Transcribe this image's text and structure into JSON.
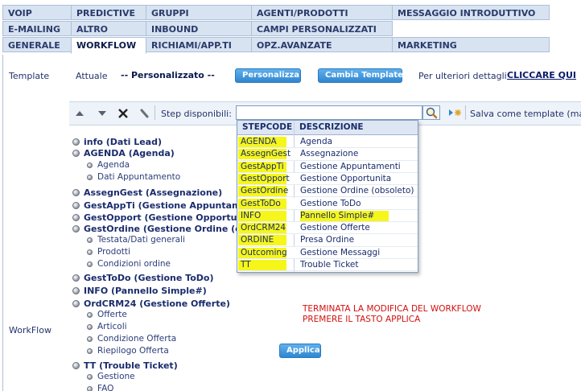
{
  "tabs": {
    "row1": [
      "VOIP",
      "PREDICTIVE",
      "GRUPPI",
      "AGENTI/PRODOTTI",
      "MESSAGGIO INTRODUTTIVO"
    ],
    "row2": [
      "E-MAILING",
      "ALTRO",
      "INBOUND",
      "CAMPI PERSONALIZZATI"
    ],
    "row3": [
      "GENERALE",
      "WORKFLOW",
      "RICHIAMI/APP.TI",
      "OPZ.AVANZATE",
      "MARKETING"
    ],
    "active": "WORKFLOW"
  },
  "template": {
    "label": "Template",
    "current_label": "Attuale",
    "current_value": "-- Personalizzato --",
    "customize_button": "Personalizza",
    "change_button": "Cambia Template",
    "details_text": "Per ulteriori dettagli",
    "details_link": "CLICCARE QUI"
  },
  "toolbar": {
    "up_icon": "arrow-up-icon",
    "down_icon": "arrow-down-icon",
    "delete_icon": "close-icon",
    "edit_icon": "pencil-icon",
    "steps_label": "Step disponibili:",
    "steps_value": "",
    "save_template": "Salva come template (max"
  },
  "dropdown": {
    "col_code": "STEPCODE",
    "col_desc": "DESCRIZIONE",
    "rows": [
      {
        "code": "AGENDA",
        "desc": "Agenda"
      },
      {
        "code": "AssegnGest",
        "desc": "Assegnazione"
      },
      {
        "code": "GestAppTi",
        "desc": "Gestione Appuntamenti"
      },
      {
        "code": "GestOpport",
        "desc": "Gestione Opportunita"
      },
      {
        "code": "GestOrdine",
        "desc": "Gestione Ordine (obsoleto)"
      },
      {
        "code": "GestToDo",
        "desc": "Gestione ToDo"
      },
      {
        "code": "INFO",
        "desc": "Pannello Simple#"
      },
      {
        "code": "OrdCRM24",
        "desc": "Gestione Offerte"
      },
      {
        "code": "ORDINE",
        "desc": "Presa Ordine"
      },
      {
        "code": "Outcoming",
        "desc": "Gestione Messaggi"
      },
      {
        "code": "TT",
        "desc": "Trouble Ticket"
      }
    ]
  },
  "workflow": {
    "label": "WorkFlow",
    "tree": [
      {
        "label": "info (Dati Lead)",
        "level": 0
      },
      {
        "label": "AGENDA (Agenda)",
        "level": 0
      },
      {
        "label": "Agenda",
        "level": 1
      },
      {
        "label": "Dati Appuntamento",
        "level": 1
      },
      {
        "label": "AssegnGest (Assegnazione)",
        "level": 0
      },
      {
        "label": "GestAppTi (Gestione Appuntamen",
        "level": 0
      },
      {
        "label": "GestOpport (Gestione Opportunit",
        "level": 0
      },
      {
        "label": "GestOrdine (Gestione Ordine (obs",
        "level": 0
      },
      {
        "label": "Testata/Dati generali",
        "level": 1
      },
      {
        "label": "Prodotti",
        "level": 1
      },
      {
        "label": "Condizioni ordine",
        "level": 1
      },
      {
        "label": "GestToDo (Gestione ToDo)",
        "level": 0
      },
      {
        "label": "INFO (Pannello Simple#)",
        "level": 0
      },
      {
        "label": "OrdCRM24 (Gestione Offerte)",
        "level": 0
      },
      {
        "label": "Offerte",
        "level": 1
      },
      {
        "label": "Articoli",
        "level": 1
      },
      {
        "label": "Condizione Offerta",
        "level": 1
      },
      {
        "label": "Riepilogo Offerta",
        "level": 1
      },
      {
        "label": "TT (Trouble Ticket)",
        "level": 0
      },
      {
        "label": "Gestione",
        "level": 1
      },
      {
        "label": "FAQ",
        "level": 1
      }
    ],
    "notice_line1": "TERMINATA LA MODIFICA DEL WORKFLOW",
    "notice_line2": "PREMERE IL TASTO APPLICA",
    "apply_button": "Applica"
  },
  "colors": {
    "highlight": "#f6f61a",
    "notice": "#d01010",
    "button": "#2f86cf",
    "tab_bg": "#d7e3f1"
  }
}
